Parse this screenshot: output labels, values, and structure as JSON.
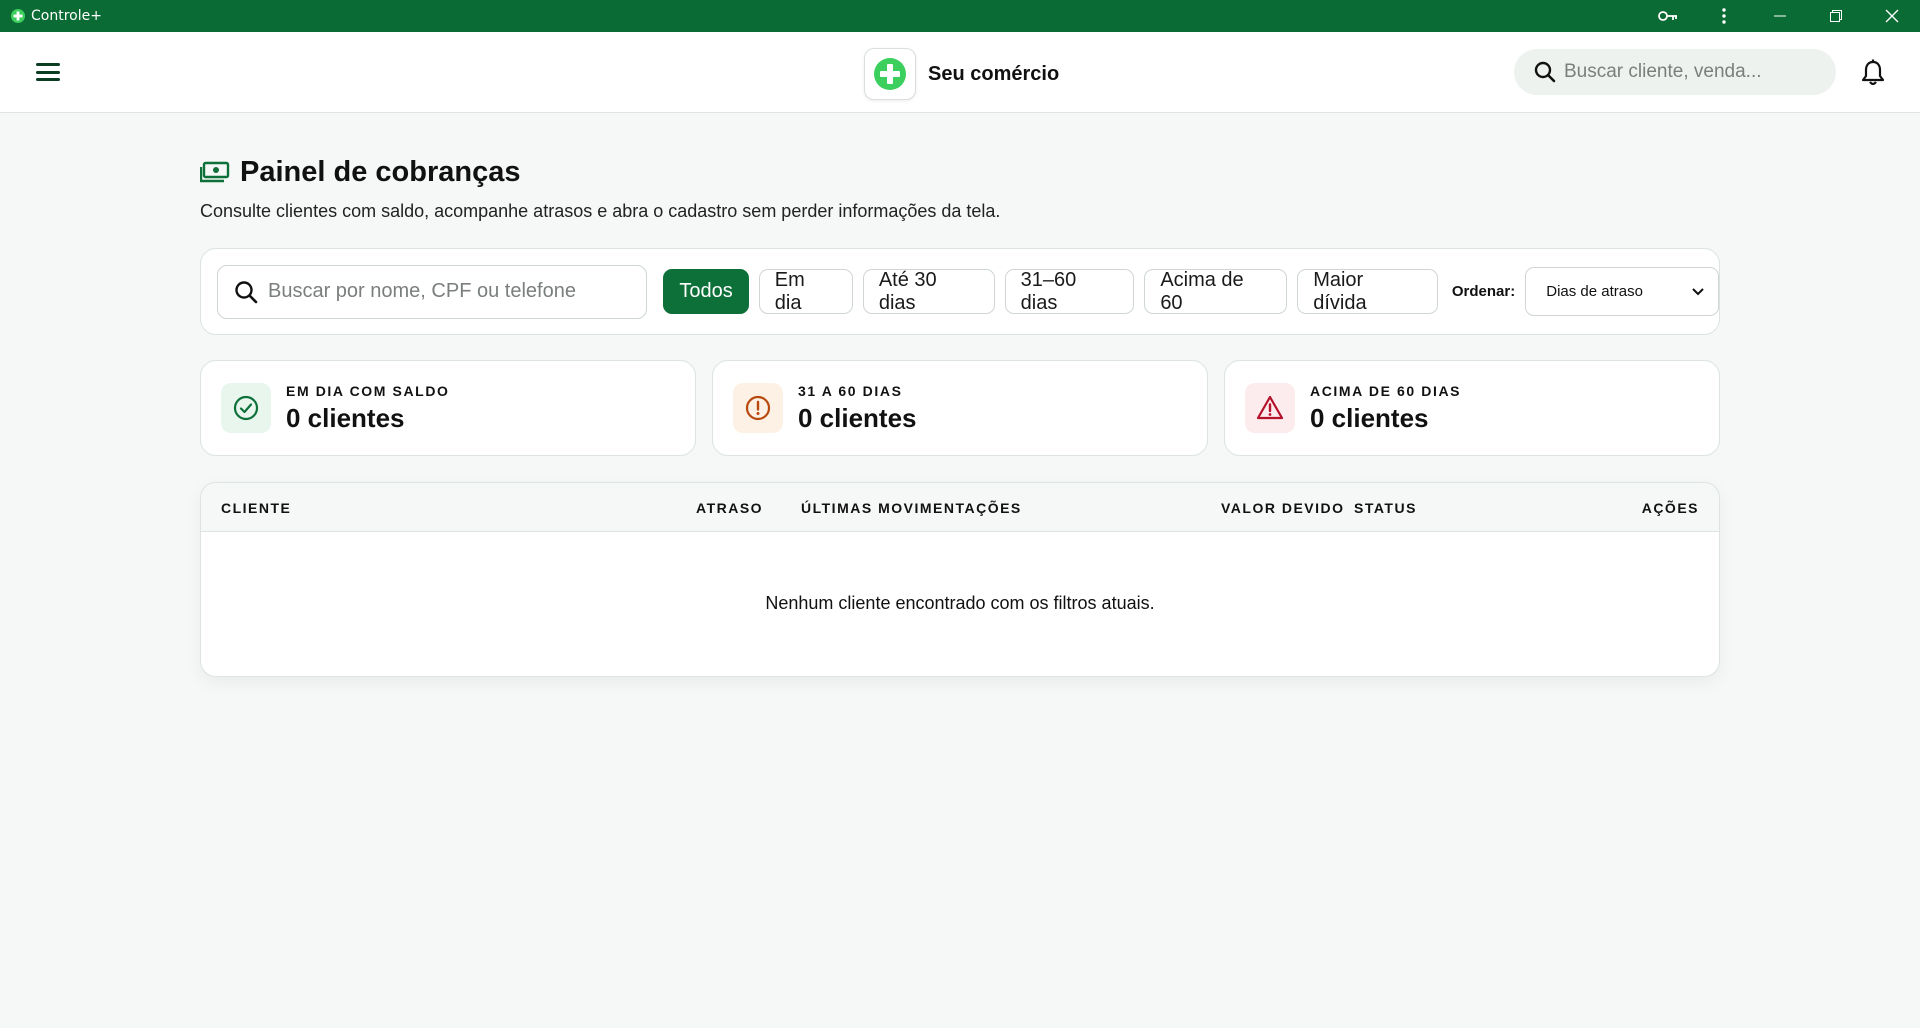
{
  "window": {
    "title": "Controle+",
    "controls": [
      "key-icon",
      "more-vertical-icon",
      "minimize-icon",
      "restore-icon",
      "close-icon"
    ]
  },
  "header": {
    "brand_name": "Seu comércio",
    "search_placeholder": "Buscar cliente, venda..."
  },
  "page": {
    "title": "Painel de cobranças",
    "subtitle": "Consulte clientes com saldo, acompanhe atrasos e abra o cadastro sem perder informações da tela."
  },
  "filters": {
    "search_placeholder": "Buscar por nome, CPF ou telefone",
    "chips": [
      "Todos",
      "Em dia",
      "Até 30 dias",
      "31–60 dias",
      "Acima de 60",
      "Maior dívida"
    ],
    "active_chip": "Todos",
    "order_label": "Ordenar:",
    "order_value": "Dias de atraso"
  },
  "stats": [
    {
      "label": "EM DIA COM SALDO",
      "value": "0 clientes",
      "icon": "check-circle-icon",
      "color": "#0e7039",
      "bg": "#e8f6ee"
    },
    {
      "label": "31 A 60 DIAS",
      "value": "0 clientes",
      "icon": "alert-circle-icon",
      "color": "#b8480c",
      "bg": "#fdf1e6"
    },
    {
      "label": "ACIMA DE 60 DIAS",
      "value": "0 clientes",
      "icon": "warning-triangle-icon",
      "color": "#b4132a",
      "bg": "#fdecee"
    }
  ],
  "table": {
    "columns": {
      "cliente": "CLIENTE",
      "atraso": "ATRASO",
      "movimentacoes": "ÚLTIMAS MOVIMENTAÇÕES",
      "valor": "VALOR DEVIDO",
      "status": "STATUS",
      "acoes": "AÇÕES"
    },
    "empty_message": "Nenhum cliente encontrado com os filtros atuais."
  },
  "colors": {
    "titlebar": "#0b6b35",
    "accent": "#0e7039"
  }
}
